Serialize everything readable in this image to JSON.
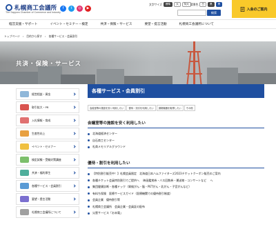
{
  "header": {
    "logo": "札幌商工会議所",
    "logo_sub": "The Sapporo Chamber of Commerce and Industry",
    "sns": [
      {
        "icon": "facebook-icon",
        "color": "#1877f2"
      },
      {
        "icon": "twitter-icon",
        "color": "#1d9bf0"
      },
      {
        "icon": "instagram-icon",
        "color": "#e1306c"
      },
      {
        "icon": "youtube-icon",
        "color": "#e02020"
      }
    ],
    "font_size_label": "文字サイズ",
    "font_size_options": [
      "標準",
      "大",
      "特大"
    ],
    "color_label": "背景色",
    "color_options": [
      "白",
      "黒",
      "青"
    ],
    "search_button": "検索",
    "join_label": "入会のご案内"
  },
  "nav": {
    "items": [
      "経営支援・サポート",
      "イベント・セミナー・検定",
      "共済・保険・サービス",
      "要望・提言活動",
      "札幌商工会議所について"
    ]
  },
  "breadcrumb": [
    "トップページ",
    "目的から探す",
    "各種サービス・会員割引"
  ],
  "banner": {
    "title": "共済・保険・サービス",
    "colors": {
      "tower": "#c8583f"
    }
  },
  "sidebar": {
    "items": [
      {
        "label": "経営相談・資金",
        "icon_color": "#8fb7d9"
      },
      {
        "label": "取引拡大・PR",
        "icon_color": "#d9534f"
      },
      {
        "label": "入札情報・育成",
        "icon_color": "#e07070"
      },
      {
        "label": "生産性向上",
        "icon_color": "#e8a040"
      },
      {
        "label": "イベント・セミナー",
        "icon_color": "#f0c040"
      },
      {
        "label": "検定試験・受験対策講座",
        "icon_color": "#7cbf6b"
      },
      {
        "label": "共済・福利厚生",
        "icon_color": "#4fae9b"
      },
      {
        "label": "各種サービス・会員割引",
        "icon_color": "#5a9bd5"
      },
      {
        "label": "要望・提言活動",
        "icon_color": "#7b6fcf"
      },
      {
        "label": "札幌商工会議所について",
        "icon_color": "#a0a0a0"
      }
    ]
  },
  "main": {
    "title": "各種サービス・会員割引",
    "tabs": [
      "会議室等の施設を安く利用したい",
      "優待・割引を利用したい",
      "調剤機器を取得したい",
      "その他"
    ],
    "sections": [
      {
        "heading": "会議室等の施設を安く利用したい",
        "items": [
          "北海道経済センター",
          "自石商工センター",
          "札商メモリアルグラウンド"
        ]
      },
      {
        "heading": "優待・割引を利用したい",
        "items": [
          "【特別割引販売中！】札幌会員限定　北海道日本ハムファイターズ2023チケットクーポン販売のご案内",
          "各種チケット会員特別割引でご提供へ　 映画鑑賞券・バス回数券・運送物・コンサートなど　 へ",
          "集団健康診断・各種ドック（胃検がん・脳・PETがん・乳がん・子宮がんなど）",
          "有料ち保険　医療サービスガイド（医療機関での優待割引制度）",
          "会員企業　優待割引等",
          "札幌商工会議所　会員企業・会員証の配布",
          "災害サービス「お未電」"
        ]
      }
    ]
  }
}
